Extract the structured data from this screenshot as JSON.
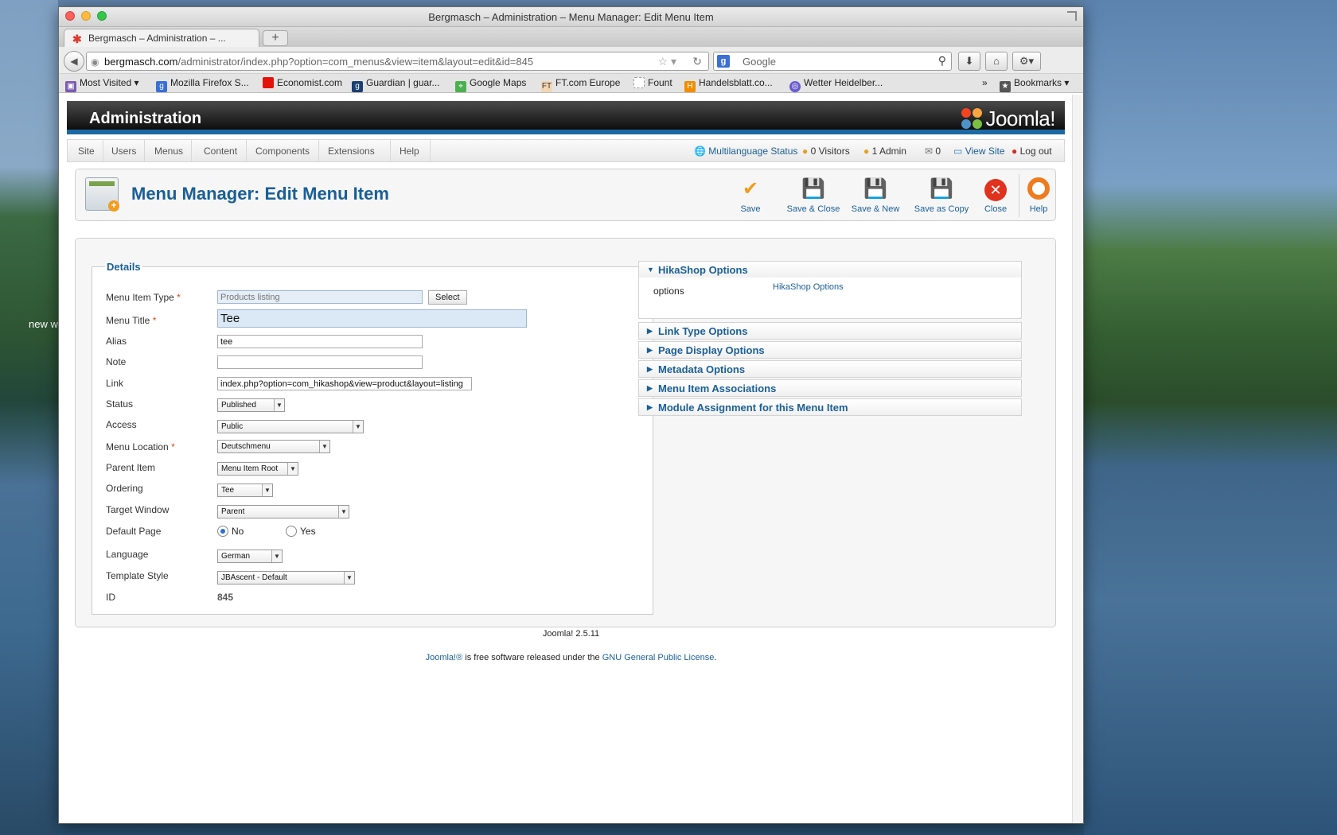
{
  "desktop": {
    "label": "new w"
  },
  "window": {
    "title": "Bergmasch – Administration – Menu Manager: Edit Menu Item"
  },
  "tab": {
    "label": "Bergmasch – Administration – ...",
    "new_tab": "+"
  },
  "nav": {
    "url_domain": "bergmasch.com",
    "url_path": "/administrator/index.php?option=com_menus&view=item&layout=edit&id=845",
    "search_placeholder": "Google"
  },
  "bookmarks": {
    "items": [
      {
        "label": "Most Visited",
        "icon": "most-visited-icon",
        "color": "#7b5bb0"
      },
      {
        "label": "Mozilla Firefox S...",
        "icon": "google-icon",
        "color": "#3a6fd6"
      },
      {
        "label": "Economist.com",
        "icon": "economist-icon",
        "color": "#e3120b"
      },
      {
        "label": "Guardian | guar...",
        "icon": "guardian-icon",
        "color": "#1b3f6e"
      },
      {
        "label": "Google Maps",
        "icon": "maps-icon",
        "color": "#4caf50"
      },
      {
        "label": "FT.com Europe",
        "icon": "ft-icon",
        "color": "#f2d6b3"
      },
      {
        "label": "Fount",
        "icon": "page-icon",
        "color": "#ffffff"
      },
      {
        "label": "Handelsblatt.co...",
        "icon": "handelsblatt-icon",
        "color": "#f28c00"
      },
      {
        "label": "Wetter Heidelber...",
        "icon": "weather-icon",
        "color": "#6a5acd"
      }
    ],
    "overflow": "»",
    "bookmarks_menu": "Bookmarks"
  },
  "admin": {
    "title": "Administration",
    "logo_text": "Joomla!"
  },
  "menu": {
    "items": [
      "Site",
      "Users",
      "Menus",
      "Content",
      "Components",
      "Extensions",
      "Help"
    ]
  },
  "status": {
    "multilanguage": "Multilanguage Status",
    "visitors": "0 Visitors",
    "admin": "1 Admin",
    "messages": "0",
    "view_site": "View Site",
    "logout": "Log out"
  },
  "page": {
    "title": "Menu Manager: Edit Menu Item"
  },
  "toolbar": {
    "save": "Save",
    "save_close": "Save & Close",
    "save_new": "Save & New",
    "save_copy": "Save as Copy",
    "close": "Close",
    "help": "Help"
  },
  "details": {
    "legend": "Details",
    "menu_item_type_label": "Menu Item Type",
    "menu_item_type_value": "Products listing",
    "select_button": "Select",
    "menu_title_label": "Menu Title",
    "menu_title_value": "Tee",
    "alias_label": "Alias",
    "alias_value": "tee",
    "note_label": "Note",
    "note_value": "",
    "link_label": "Link",
    "link_value": "index.php?option=com_hikashop&view=product&layout=listing",
    "status_label": "Status",
    "status_value": "Published",
    "access_label": "Access",
    "access_value": "Public",
    "menu_location_label": "Menu Location",
    "menu_location_value": "Deutschmenu",
    "parent_item_label": "Parent Item",
    "parent_item_value": "Menu Item Root",
    "ordering_label": "Ordering",
    "ordering_value": "Tee",
    "target_window_label": "Target Window",
    "target_window_value": "Parent",
    "default_page_label": "Default Page",
    "default_no": "No",
    "default_yes": "Yes",
    "language_label": "Language",
    "language_value": "German",
    "template_style_label": "Template Style",
    "template_style_value": "JBAscent - Default",
    "id_label": "ID",
    "id_value": "845",
    "required_mark": "*"
  },
  "panels": {
    "hikashop": "HikaShop Options",
    "hikashop_options_label": "options",
    "hikashop_options_link": "HikaShop Options",
    "link_type": "Link Type Options",
    "page_display": "Page Display Options",
    "metadata": "Metadata Options",
    "associations": "Menu Item Associations",
    "module_assignment": "Module Assignment for this Menu Item"
  },
  "footer": {
    "version": "Joomla! 2.5.11",
    "joomla_link": "Joomla!®",
    "license_text": "is free software released under the",
    "license_link": "GNU General Public License",
    "period": "."
  }
}
